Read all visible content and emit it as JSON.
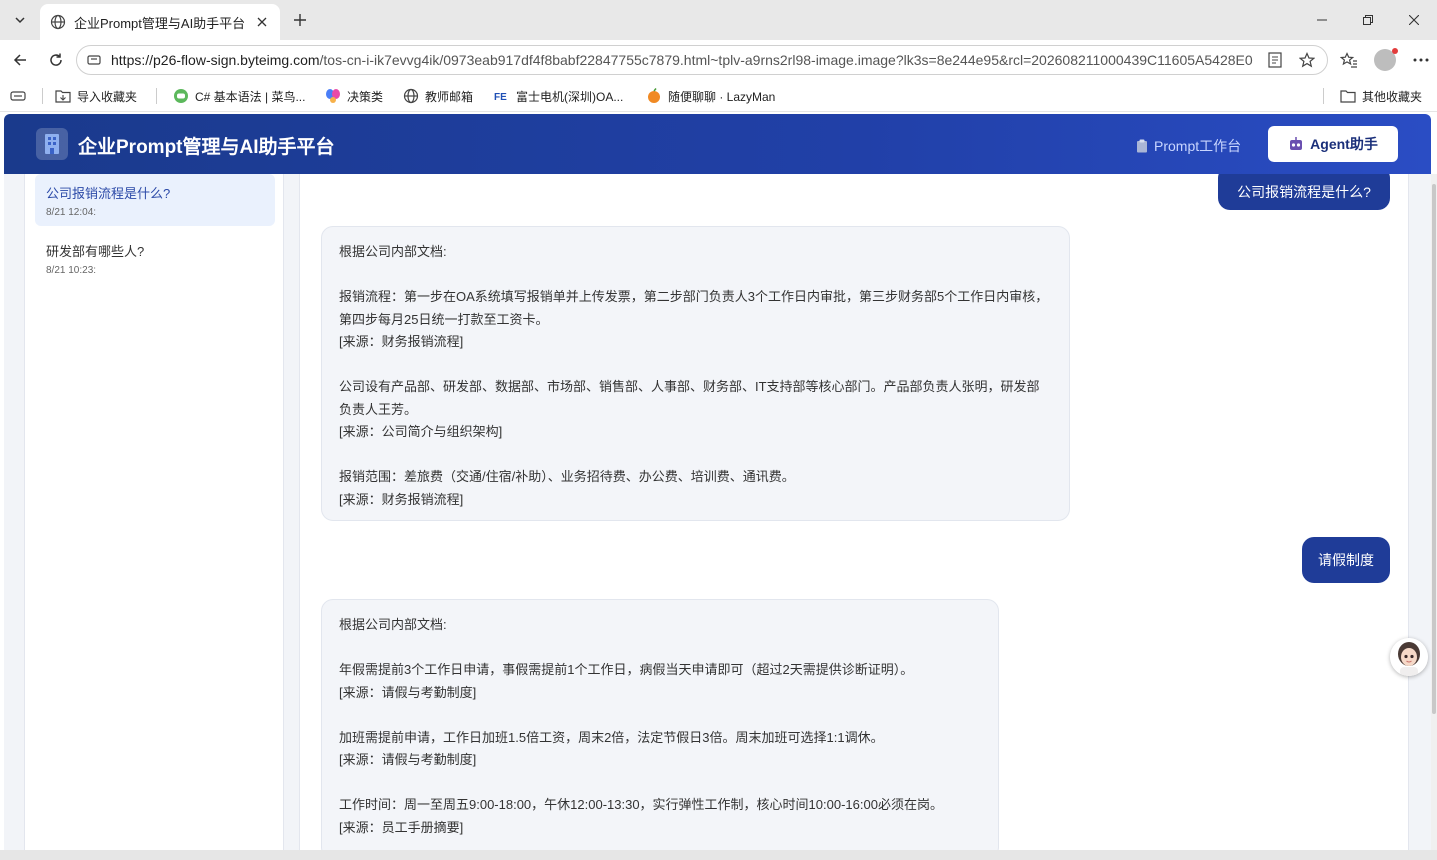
{
  "browser": {
    "tab_title": "企业Prompt管理与AI助手平台",
    "url_host": "https://p26-flow-sign.byteimg.com",
    "url_path": "/tos-cn-i-ik7evvg4ik/0973eab917df4f8babf22847755c7879.html~tplv-a9rns2rl98-image.image?lk3s=8e244e95&rcl=202608211000439C11605A5428E0...",
    "bookmarks": [
      "导入收藏夹",
      "C# 基本语法 | 菜鸟...",
      "决策类",
      "教师邮箱",
      "富士电机(深圳)OA...",
      "随便聊聊 · LazyMan"
    ],
    "other_bookmarks": "其他收藏夹"
  },
  "app": {
    "title": "企业Prompt管理与AI助手平台",
    "nav_prompt": "Prompt工作台",
    "nav_agent": "Agent助手"
  },
  "sidebar": {
    "conversations": [
      {
        "question": "公司报销流程是什么?",
        "time": "8/21 12:04:"
      },
      {
        "question": "研发部有哪些人?",
        "time": "8/21 10:23:"
      }
    ]
  },
  "chat": {
    "user_msg_1": "公司报销流程是什么?",
    "ai_msg_1": {
      "intro": "根据公司内部文档:",
      "p1": "报销流程：第一步在OA系统填写报销单并上传发票，第二步部门负责人3个工作日内审批，第三步财务部5个工作日内审核，第四步每月25日统一打款至工资卡。",
      "s1": "[来源：财务报销流程]",
      "p2": "公司设有产品部、研发部、数据部、市场部、销售部、人事部、财务部、IT支持部等核心部门。产品部负责人张明，研发部负责人王芳。",
      "s2": "[来源：公司简介与组织架构]",
      "p3": "报销范围：差旅费（交通/住宿/补助）、业务招待费、办公费、培训费、通讯费。",
      "s3": "[来源：财务报销流程]"
    },
    "user_msg_2": "请假制度",
    "ai_msg_2": {
      "intro": "根据公司内部文档:",
      "p1": "年假需提前3个工作日申请，事假需提前1个工作日，病假当天申请即可（超过2天需提供诊断证明）。",
      "s1": "[来源：请假与考勤制度]",
      "p2": "加班需提前申请，工作日加班1.5倍工资，周末2倍，法定节假日3倍。周末加班可选择1:1调休。",
      "s2": "[来源：请假与考勤制度]",
      "p3": "工作时间：周一至周五9:00-18:00，午休12:00-13:30，实行弹性工作制，核心时间10:00-16:00必须在岗。",
      "s3": "[来源：员工手册摘要]"
    }
  },
  "colors": {
    "header_start": "#1a3a8c",
    "header_end": "#2a4dc4",
    "user_bubble": "#1f3c98",
    "active_conv": "#eaf1fd"
  }
}
